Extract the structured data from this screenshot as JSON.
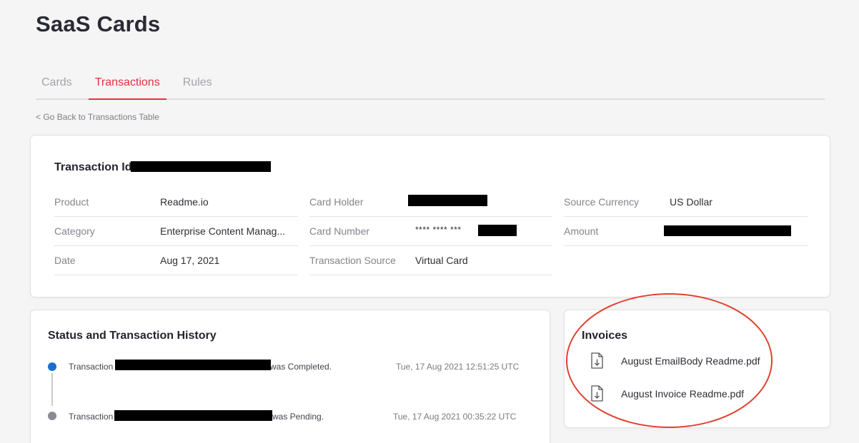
{
  "page": {
    "title": "SaaS Cards"
  },
  "tabs": [
    {
      "label": "Cards",
      "active": false
    },
    {
      "label": "Transactions",
      "active": true
    },
    {
      "label": "Rules",
      "active": false
    }
  ],
  "back_link": "< Go Back to Transactions Table",
  "transaction": {
    "title": "Transaction Id",
    "fields": {
      "product": {
        "label": "Product",
        "value": "Readme.io"
      },
      "category": {
        "label": "Category",
        "value": "Enterprise Content Manag..."
      },
      "date": {
        "label": "Date",
        "value": "Aug 17, 2021"
      },
      "card_holder": {
        "label": "Card Holder",
        "value": ""
      },
      "card_number": {
        "label": "Card Number",
        "value": "**** **** ***"
      },
      "transaction_source": {
        "label": "Transaction Source",
        "value": "Virtual Card"
      },
      "source_currency": {
        "label": "Source Currency",
        "value": "US Dollar"
      },
      "amount": {
        "label": "Amount",
        "value": ""
      }
    }
  },
  "history": {
    "title": "Status and Transaction History",
    "items": [
      {
        "prefix": "Transaction",
        "suffix": "was Completed.",
        "time": "Tue, 17 Aug 2021 12:51:25 UTC",
        "status_color": "#1a6fd1"
      },
      {
        "prefix": "Transaction",
        "suffix": "was Pending.",
        "time": "Tue, 17 Aug 2021 00:35:22 UTC",
        "status_color": "#8a8a92"
      }
    ]
  },
  "invoices": {
    "title": "Invoices",
    "items": [
      {
        "name": "August EmailBody Readme.pdf",
        "icon": "file-download-icon"
      },
      {
        "name": "August Invoice Readme.pdf",
        "icon": "file-download-icon"
      }
    ]
  },
  "colors": {
    "accent": "#e0333d",
    "annotation": "#e1402f",
    "redaction": "#000000"
  }
}
